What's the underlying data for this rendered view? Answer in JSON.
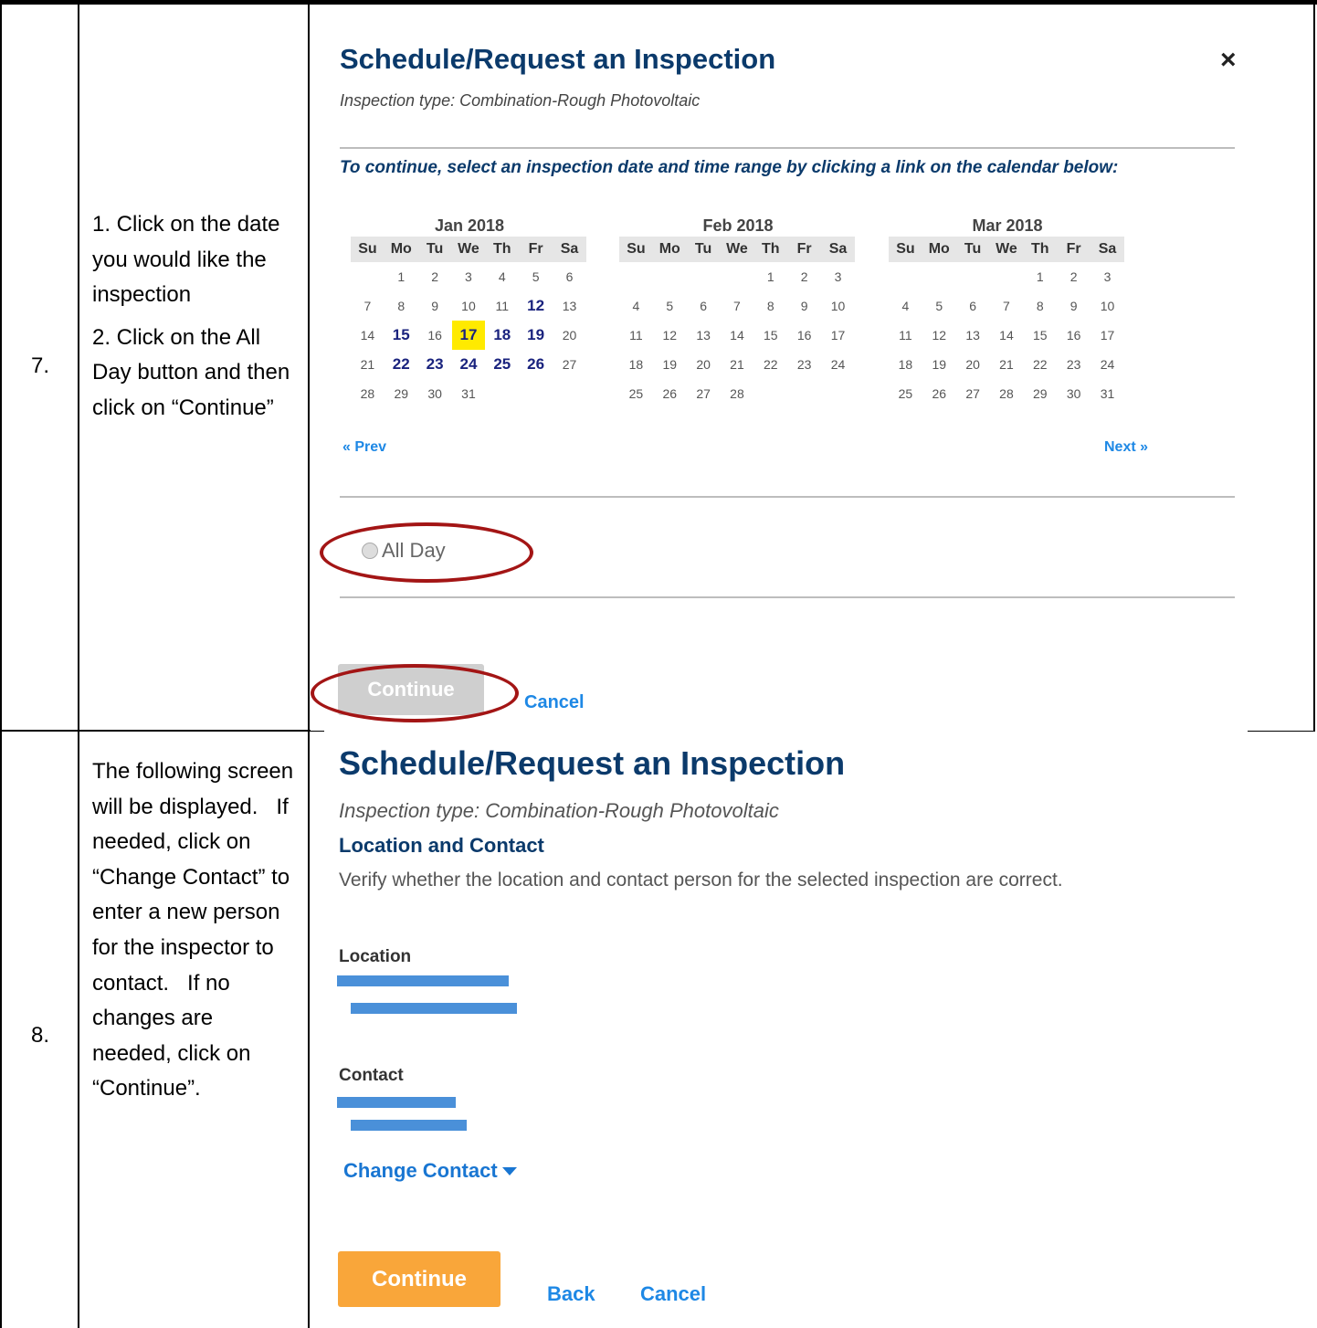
{
  "table": {
    "rows": [
      {
        "number": "7.",
        "instructions": [
          "1. Click on the date you would like the inspection",
          "2. Click on the All Day button and then click on “Continue”"
        ]
      },
      {
        "number": "8.",
        "instructions": [
          "The following screen will be displayed.   If needed, click on “Change Contact” to enter a new person for the inspector to contact.   If no changes are needed, click on “Continue”."
        ]
      }
    ]
  },
  "step7_screen": {
    "title": "Schedule/Request an Inspection",
    "close_label": "×",
    "inspection_type": "Inspection type: Combination-Rough Photovoltaic",
    "prompt": "To continue, select an inspection date and time range by clicking a link on the calendar below:",
    "weekday_headers": [
      "Su",
      "Mo",
      "Tu",
      "We",
      "Th",
      "Fr",
      "Sa"
    ],
    "calendars": [
      {
        "title": "Jan 2018",
        "weeks": [
          [
            "",
            "1",
            "2",
            "3",
            "4",
            "5",
            "6"
          ],
          [
            "7",
            "8",
            "9",
            "10",
            "11",
            "12",
            "13"
          ],
          [
            "14",
            "15",
            "16",
            "17",
            "18",
            "19",
            "20"
          ],
          [
            "21",
            "22",
            "23",
            "24",
            "25",
            "26",
            "27"
          ],
          [
            "28",
            "29",
            "30",
            "31",
            "",
            "",
            ""
          ]
        ],
        "available_days": [
          "12",
          "15",
          "17",
          "18",
          "19",
          "22",
          "23",
          "24",
          "25",
          "26"
        ],
        "selected_day": "17"
      },
      {
        "title": "Feb 2018",
        "weeks": [
          [
            "",
            "",
            "",
            "",
            "1",
            "2",
            "3"
          ],
          [
            "4",
            "5",
            "6",
            "7",
            "8",
            "9",
            "10"
          ],
          [
            "11",
            "12",
            "13",
            "14",
            "15",
            "16",
            "17"
          ],
          [
            "18",
            "19",
            "20",
            "21",
            "22",
            "23",
            "24"
          ],
          [
            "25",
            "26",
            "27",
            "28",
            "",
            "",
            ""
          ]
        ],
        "available_days": [],
        "selected_day": ""
      },
      {
        "title": "Mar 2018",
        "weeks": [
          [
            "",
            "",
            "",
            "",
            "1",
            "2",
            "3"
          ],
          [
            "4",
            "5",
            "6",
            "7",
            "8",
            "9",
            "10"
          ],
          [
            "11",
            "12",
            "13",
            "14",
            "15",
            "16",
            "17"
          ],
          [
            "18",
            "19",
            "20",
            "21",
            "22",
            "23",
            "24"
          ],
          [
            "25",
            "26",
            "27",
            "28",
            "29",
            "30",
            "31"
          ]
        ],
        "available_days": [],
        "selected_day": ""
      }
    ],
    "prev_label": "« Prev",
    "next_label": "Next »",
    "all_day_label": "All Day",
    "continue_label": "Continue",
    "cancel_label": "Cancel"
  },
  "step8_screen": {
    "title": "Schedule/Request an Inspection",
    "inspection_type": "Inspection type: Combination-Rough Photovoltaic",
    "section_title": "Location and Contact",
    "description": "Verify whether the location and contact person for the selected inspection are correct.",
    "location_label": "Location",
    "contact_label": "Contact",
    "change_contact_label": "Change Contact",
    "continue_label": "Continue",
    "back_label": "Back",
    "cancel_label": "Cancel"
  },
  "colors": {
    "heading_navy": "#0b3a6b",
    "link_blue": "#1e88e5",
    "highlight_yellow": "#ffea00",
    "annotation_red": "#a31515",
    "button_orange": "#f9a63a",
    "redaction_blue": "#4a90d9"
  }
}
